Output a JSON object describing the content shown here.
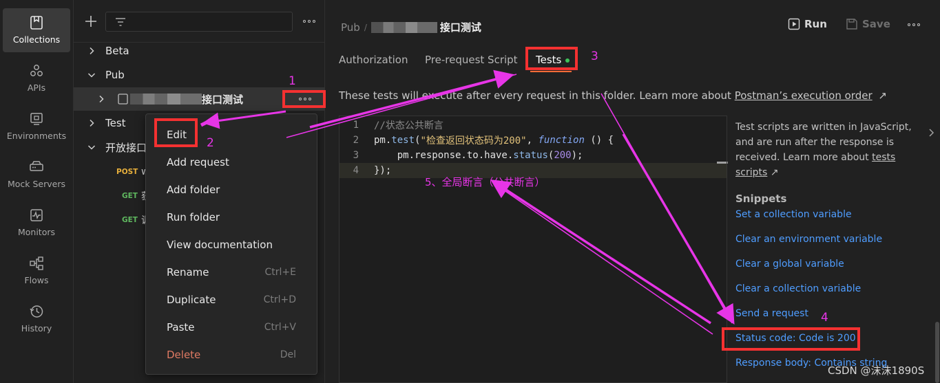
{
  "rail": {
    "items": [
      {
        "label": "Collections",
        "icon": "collections-icon",
        "active": true
      },
      {
        "label": "APIs",
        "icon": "apis-icon"
      },
      {
        "label": "Environments",
        "icon": "environments-icon"
      },
      {
        "label": "Mock Servers",
        "icon": "mock-servers-icon"
      },
      {
        "label": "Monitors",
        "icon": "monitors-icon"
      },
      {
        "label": "Flows",
        "icon": "flows-icon"
      },
      {
        "label": "History",
        "icon": "history-icon"
      }
    ]
  },
  "sidebar": {
    "tree": [
      {
        "label": "Beta"
      },
      {
        "label": "Pub"
      },
      {
        "label": "接口测试"
      },
      {
        "label": "Test"
      },
      {
        "label": "开放接口"
      }
    ],
    "requests": [
      {
        "method": "POST",
        "name": "w"
      },
      {
        "method": "GET",
        "name": "获"
      },
      {
        "method": "GET",
        "name": "调"
      }
    ]
  },
  "context_menu": {
    "items": [
      {
        "label": "Edit",
        "shortcut": ""
      },
      {
        "label": "Add request",
        "shortcut": ""
      },
      {
        "label": "Add folder",
        "shortcut": ""
      },
      {
        "label": "Run folder",
        "shortcut": ""
      },
      {
        "label": "View documentation",
        "shortcut": ""
      },
      {
        "label": "Rename",
        "shortcut": "Ctrl+E"
      },
      {
        "label": "Duplicate",
        "shortcut": "Ctrl+D"
      },
      {
        "label": "Paste",
        "shortcut": "Ctrl+V"
      },
      {
        "label": "Delete",
        "shortcut": "Del"
      }
    ]
  },
  "header": {
    "crumb_parent": "Pub",
    "crumb_sep": "/",
    "folder_name": "接口测试",
    "run_label": "Run",
    "save_label": "Save"
  },
  "tabs": {
    "authorization": "Authorization",
    "pre_request": "Pre-request Script",
    "tests": "Tests"
  },
  "description": {
    "text": "These tests will execute after every request in this folder. Learn more about ",
    "link": "Postman’s execution order",
    "arrow": "↗"
  },
  "code": {
    "line_numbers": [
      "1",
      "2",
      "3",
      "4"
    ],
    "l1": "//状态公共断言",
    "l2_obj": "pm.",
    "l2_fn": "test",
    "l2_open": "(",
    "l2_str": "\"检查返回状态码为200\"",
    "l2_comma": ", ",
    "l2_kw": "function",
    "l2_rest": " () {",
    "l3_pre": "    pm.response.to.have.",
    "l3_fn": "status",
    "l3_open": "(",
    "l3_num": "200",
    "l3_close": ");",
    "l4": "});"
  },
  "help": {
    "text": "Test scripts are written in JavaScript, and are run after the response is received. Learn more about ",
    "link": "tests scripts",
    "arrow": "↗",
    "snippets_title": "Snippets",
    "snippets": [
      "Set a collection variable",
      "Clear an environment variable",
      "Clear a global variable",
      "Clear a collection variable",
      "Send a request",
      "Status code: Code is 200",
      "Response body: Contains string"
    ]
  },
  "annotations": {
    "n1": "1",
    "n2": "2",
    "n3": "3",
    "n4": "4",
    "n5": "5、全局断言（公共断言）"
  },
  "watermark": "CSDN @沫沫1890S",
  "colors": {
    "accent": "#ff6c37",
    "snippet": "#4f9dff",
    "annotation_box": "#f43131",
    "annotation_arrow": "#e735e7"
  }
}
